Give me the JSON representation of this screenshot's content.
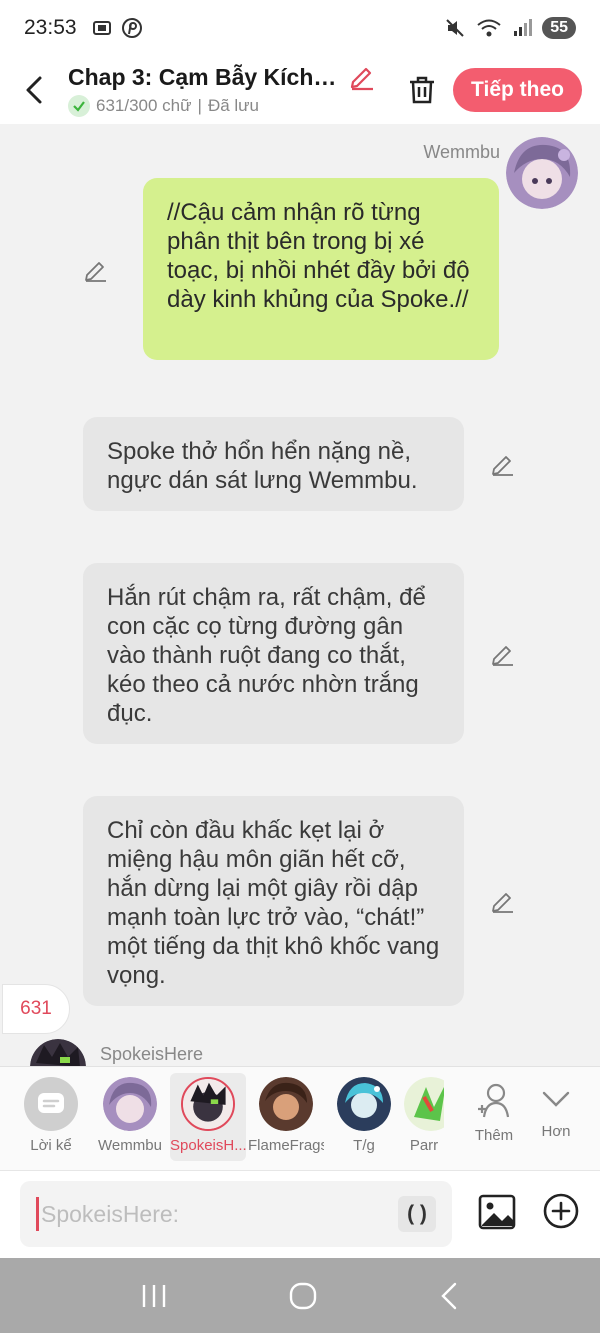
{
  "status_bar": {
    "time": "23:53",
    "battery_level": "55"
  },
  "header": {
    "title": "Chap 3: Cạm Bẫy Kích ...",
    "word_count": "631/300 chữ",
    "save_status": "Đã lưu",
    "next_label": "Tiếp theo"
  },
  "chat": {
    "user_name": "Wemmbu",
    "messages": [
      {
        "type": "user",
        "text": "//Cậu cảm nhận rõ từng phân thịt bên trong bị xé toạc, bị nhồi nhét đầy bởi độ dày kinh khủng của Spoke.//"
      },
      {
        "type": "narration",
        "text": "Spoke thở hổn hển nặng nề, ngực dán sát lưng Wemmbu."
      },
      {
        "type": "narration",
        "text": "Hắn rút chậm ra, rất chậm, để con cặc cọ từng đường gân vào thành ruột đang co thắt, kéo theo cả nước nhờn trắng đục."
      },
      {
        "type": "narration",
        "text": "Chỉ còn đầu khấc kẹt lại ở miệng hậu môn giãn hết cỡ, hắn dừng lại một giây rồi dập mạnh toàn lực trở vào, “chát!” một tiếng da thịt khô khốc vang vọng."
      }
    ],
    "counter": "631",
    "peek_name": "SpokeisHere"
  },
  "characters": [
    {
      "label": "Lời kể",
      "icon": "narration-icon"
    },
    {
      "label": "Wemmbu"
    },
    {
      "label": "SpokeisH...",
      "selected": true
    },
    {
      "label": "FlameFrags"
    },
    {
      "label": "T/g"
    },
    {
      "label": "Parr"
    }
  ],
  "char_actions": {
    "add_label": "Thêm",
    "more_label": "Hơn"
  },
  "input": {
    "placeholder": "SpokeisHere:",
    "paren_label": "( )"
  },
  "colors": {
    "accent": "#f35d6f",
    "user_bubble": "#d5f08e",
    "narration_bubble": "#e6e6e6"
  }
}
